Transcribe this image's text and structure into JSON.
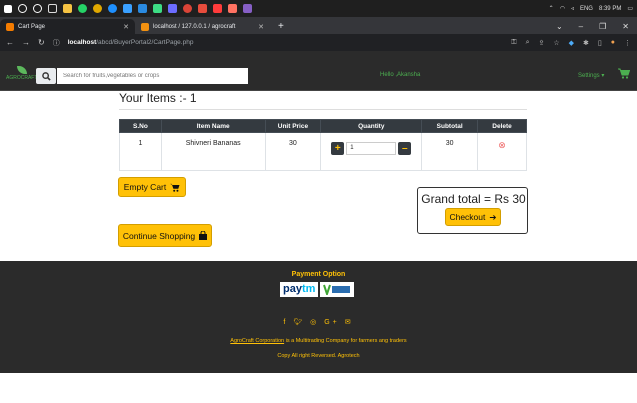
{
  "system": {
    "lang": "ENG",
    "time": "8:39 PM"
  },
  "browser": {
    "tabs": [
      {
        "label": "Cart Page",
        "active": true
      },
      {
        "label": "localhost / 127.0.0.1 / agrocraft",
        "active": false
      }
    ],
    "url_host": "localhost",
    "url_path": "/abcd/BuyerPortal2/CartPage.php"
  },
  "navbar": {
    "logo_text": "AGROCRAFT",
    "search_placeholder": "Search for fruits,vegetables or crops",
    "hello": "Hello ,Akansha",
    "settings": "Settings ▾"
  },
  "cart": {
    "title": "Your Items :- 1",
    "headers": [
      "S.No",
      "Item Name",
      "Unit Price",
      "Quantity",
      "Subtotal",
      "Delete"
    ],
    "rows": [
      {
        "sno": "1",
        "item": "Shivneri Bananas",
        "price": "30",
        "qty": "1",
        "subtotal": "30"
      }
    ],
    "empty_label": "Empty Cart",
    "continue_label": "Continue Shopping",
    "grand_total": "Grand total = Rs 30",
    "checkout_label": "Checkout"
  },
  "footer": {
    "payment_title": "Payment Option",
    "about_link": "AgroCraft Corporation",
    "about_rest": " is a Multitrading Company for farmers ang traders",
    "copyright": "Copy All right Reversed.  Agrotech"
  },
  "colors": {
    "accent": "#ffc107",
    "dark": "#2b2b2b",
    "green": "#4caf50"
  }
}
